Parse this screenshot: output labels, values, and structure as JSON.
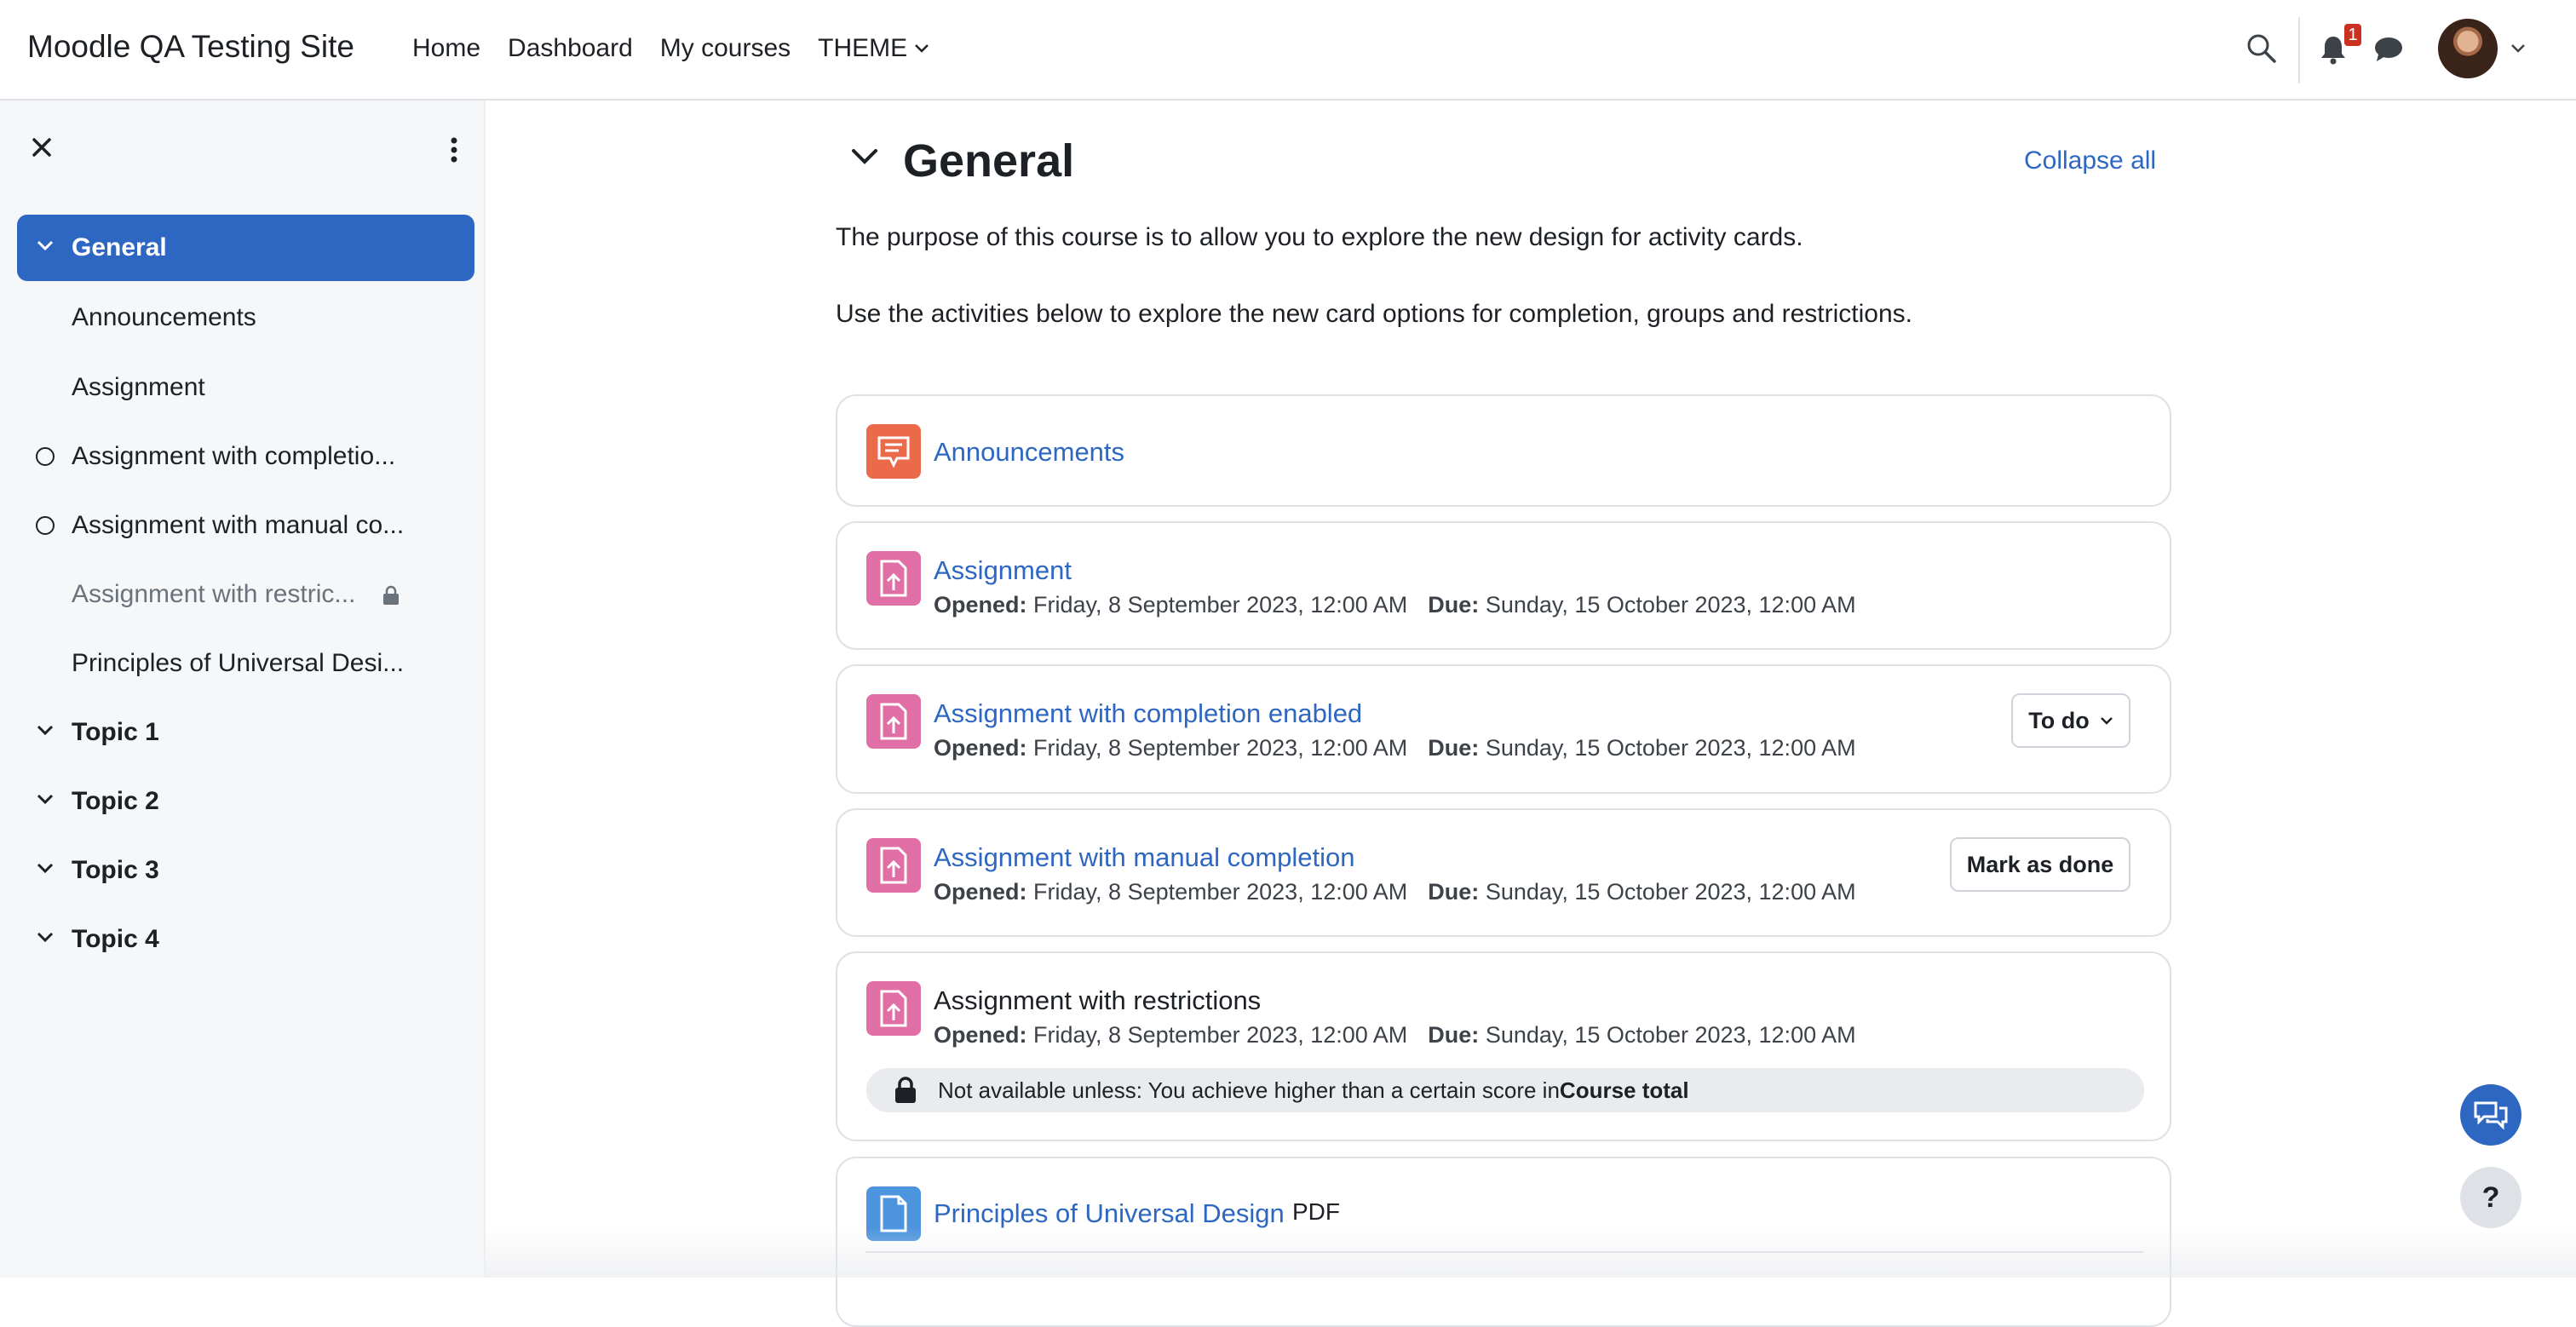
{
  "colors": {
    "accent": "#2e67c2",
    "badge": "#ca3120",
    "forum_icon": "#eb6a4a",
    "assign_icon": "#e06fa5",
    "resource_icon": "#4c94de"
  },
  "navbar": {
    "site_name": "Moodle QA Testing Site",
    "links": [
      "Home",
      "Dashboard",
      "My courses"
    ],
    "theme_label": "THEME",
    "notification_count": "1",
    "icons": [
      "search-icon",
      "bell-icon",
      "chat-icon",
      "avatar",
      "chevron-down-icon"
    ]
  },
  "sidebar": {
    "items": [
      {
        "label": "General",
        "kind": "section"
      },
      {
        "label": "Announcements",
        "kind": "activity"
      },
      {
        "label": "Assignment",
        "kind": "activity"
      },
      {
        "label": "Assignment with completio...",
        "kind": "activity-completion"
      },
      {
        "label": "Assignment with manual co...",
        "kind": "activity-completion"
      },
      {
        "label": "Assignment with restric...",
        "kind": "activity-locked"
      },
      {
        "label": "Principles of Universal Desi...",
        "kind": "activity"
      },
      {
        "label": "Topic 1",
        "kind": "section"
      },
      {
        "label": "Topic 2",
        "kind": "section"
      },
      {
        "label": "Topic 3",
        "kind": "section"
      },
      {
        "label": "Topic 4",
        "kind": "section"
      }
    ]
  },
  "section": {
    "title": "General",
    "collapse_all": "Collapse all",
    "summary": [
      "The purpose of this course is to allow you to explore the new design for activity cards.",
      "Use the activities below to explore the new card options for completion, groups and restrictions."
    ]
  },
  "activities": [
    {
      "name": "Announcements"
    },
    {
      "name": "Assignment",
      "opened_label": "Opened:",
      "opened": "Friday, 8 September 2023, 12:00 AM",
      "due_label": "Due:",
      "due": "Sunday, 15 October 2023, 12:00 AM"
    },
    {
      "name": "Assignment with completion enabled",
      "opened_label": "Opened:",
      "opened": "Friday, 8 September 2023, 12:00 AM",
      "due_label": "Due:",
      "due": "Sunday, 15 October 2023, 12:00 AM",
      "button": "To do"
    },
    {
      "name": "Assignment with manual completion",
      "opened_label": "Opened:",
      "opened": "Friday, 8 September 2023, 12:00 AM",
      "due_label": "Due:",
      "due": "Sunday, 15 October 2023, 12:00 AM",
      "button": "Mark as done"
    },
    {
      "name": "Assignment with restrictions",
      "opened_label": "Opened:",
      "opened": "Friday, 8 September 2023, 12:00 AM",
      "due_label": "Due:",
      "due": "Sunday, 15 October 2023, 12:00 AM",
      "restriction_text": "Not available unless: You achieve higher than a certain score in ",
      "restriction_bold": "Course total"
    },
    {
      "name": "Principles of Universal Design",
      "type_tag": "PDF"
    }
  ],
  "floating": {
    "help_label": "?"
  }
}
